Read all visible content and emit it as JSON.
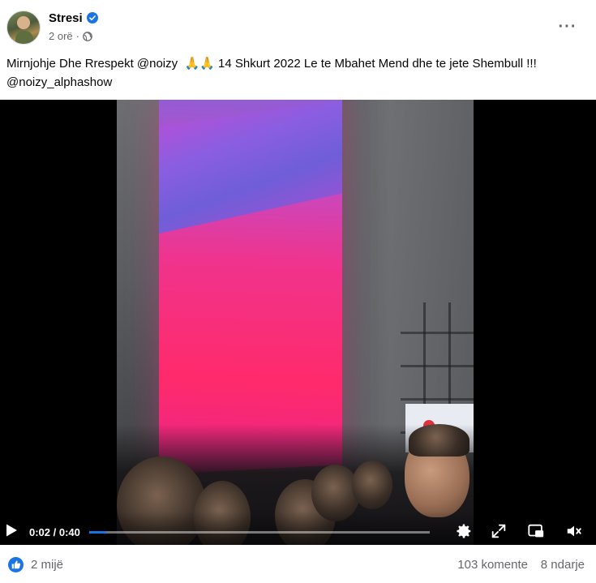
{
  "post": {
    "author": "Stresi",
    "time": "2 orë",
    "separator": "·",
    "privacy_icon": "globe-icon",
    "verified_icon": "verified-badge-icon",
    "more_label": "···",
    "text_part1": "Mirnjohje Dhe Rrespekt @noizy  ",
    "emoji": "🙏🙏",
    "text_part2": " 14 Shkurt 2022 Le te Mbahet Mend dhe te jete Shembull !!! @noizy_alphashow"
  },
  "video": {
    "current_time": "0:02",
    "time_separator": " / ",
    "duration": "0:40",
    "progress": 0.05,
    "icons": [
      "play-icon",
      "settings-gear-icon",
      "fullscreen-expand-icon",
      "picture-in-picture-icon",
      "volume-muted-icon"
    ]
  },
  "footer": {
    "reactions": "2 mijë",
    "comments": "103 komente",
    "shares": "8 ndarje"
  },
  "colors": {
    "accent": "#1b74e4",
    "secondary_text": "#65676b"
  }
}
